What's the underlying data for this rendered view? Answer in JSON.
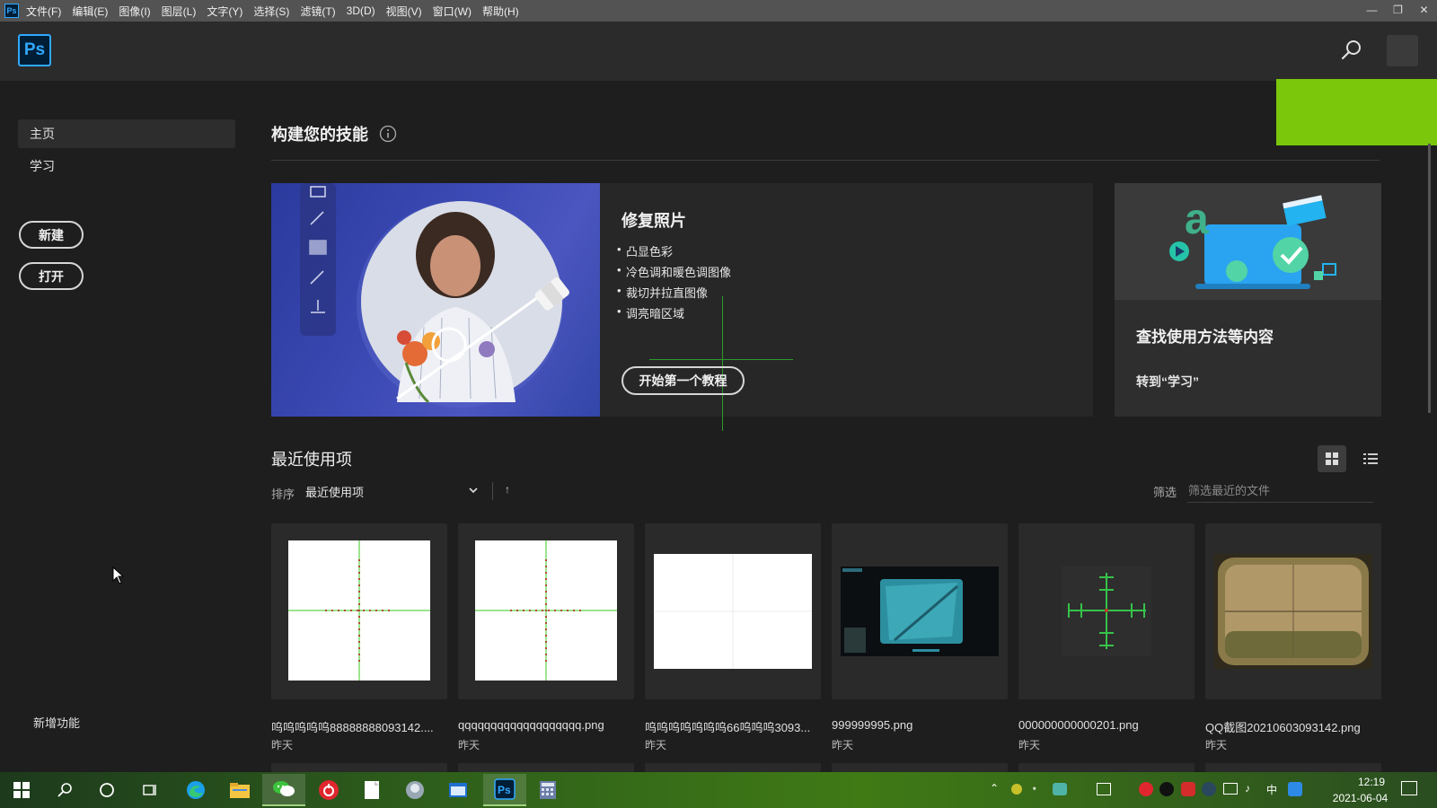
{
  "menubar": {
    "app_icon": "Ps",
    "items": [
      "文件(F)",
      "编辑(E)",
      "图像(I)",
      "图层(L)",
      "文字(Y)",
      "选择(S)",
      "滤镜(T)",
      "3D(D)",
      "视图(V)",
      "窗口(W)",
      "帮助(H)"
    ],
    "window_controls": [
      "minimize-icon",
      "restore-icon",
      "close-icon"
    ]
  },
  "header": {
    "logo": "Ps",
    "search_icon": "search-icon",
    "avatar": "avatar"
  },
  "sidebar": {
    "items": [
      {
        "label": "主页",
        "active": true
      },
      {
        "label": "学习",
        "active": false
      }
    ],
    "new_label": "新建",
    "open_label": "打开",
    "whats_new": "新增功能"
  },
  "skills": {
    "title": "构建您的技能",
    "card": {
      "title": "修复照片",
      "bullets": [
        "凸显色彩",
        "冷色调和暖色调图像",
        "裁切并拉直图像",
        "调亮暗区域"
      ],
      "button": "开始第一个教程"
    },
    "learn": {
      "title": "查找使用方法等内容",
      "link": "转到“学习”"
    }
  },
  "recent": {
    "title": "最近使用项",
    "sort_label": "排序",
    "sort_value": "最近使用项",
    "sort_direction": "↑",
    "filter_label": "筛选",
    "filter_placeholder": "筛选最近的文件",
    "files": [
      {
        "name": "呜呜呜呜呜88888888093142....",
        "date": "昨天",
        "kind": "crosshair-white"
      },
      {
        "name": "qqqqqqqqqqqqqqqqqqq.png",
        "date": "昨天",
        "kind": "crosshair-white"
      },
      {
        "name": "呜呜呜呜呜呜呜66呜呜呜3093...",
        "date": "昨天",
        "kind": "blank-white"
      },
      {
        "name": "999999995.png",
        "date": "昨天",
        "kind": "game-screenshot"
      },
      {
        "name": "000000000000201.png",
        "date": "昨天",
        "kind": "crosshair-dark"
      },
      {
        "name": "QQ截图20210603093142.png",
        "date": "昨天",
        "kind": "scope-view"
      }
    ]
  },
  "taskbar": {
    "apps": [
      "windows-start-icon",
      "search-icon",
      "cortana-icon",
      "task-view-icon",
      "edge-icon",
      "file-explorer-icon",
      "wechat-icon",
      "netease-music-icon",
      "notepad-icon",
      "app-icon",
      "window-app-icon",
      "photoshop-icon",
      "calculator-icon"
    ],
    "ime": "中",
    "time": "12:19",
    "date": "2021-06-04"
  },
  "colors": {
    "accent_green": "#7ac70c",
    "ps_blue": "#31a8ff"
  }
}
